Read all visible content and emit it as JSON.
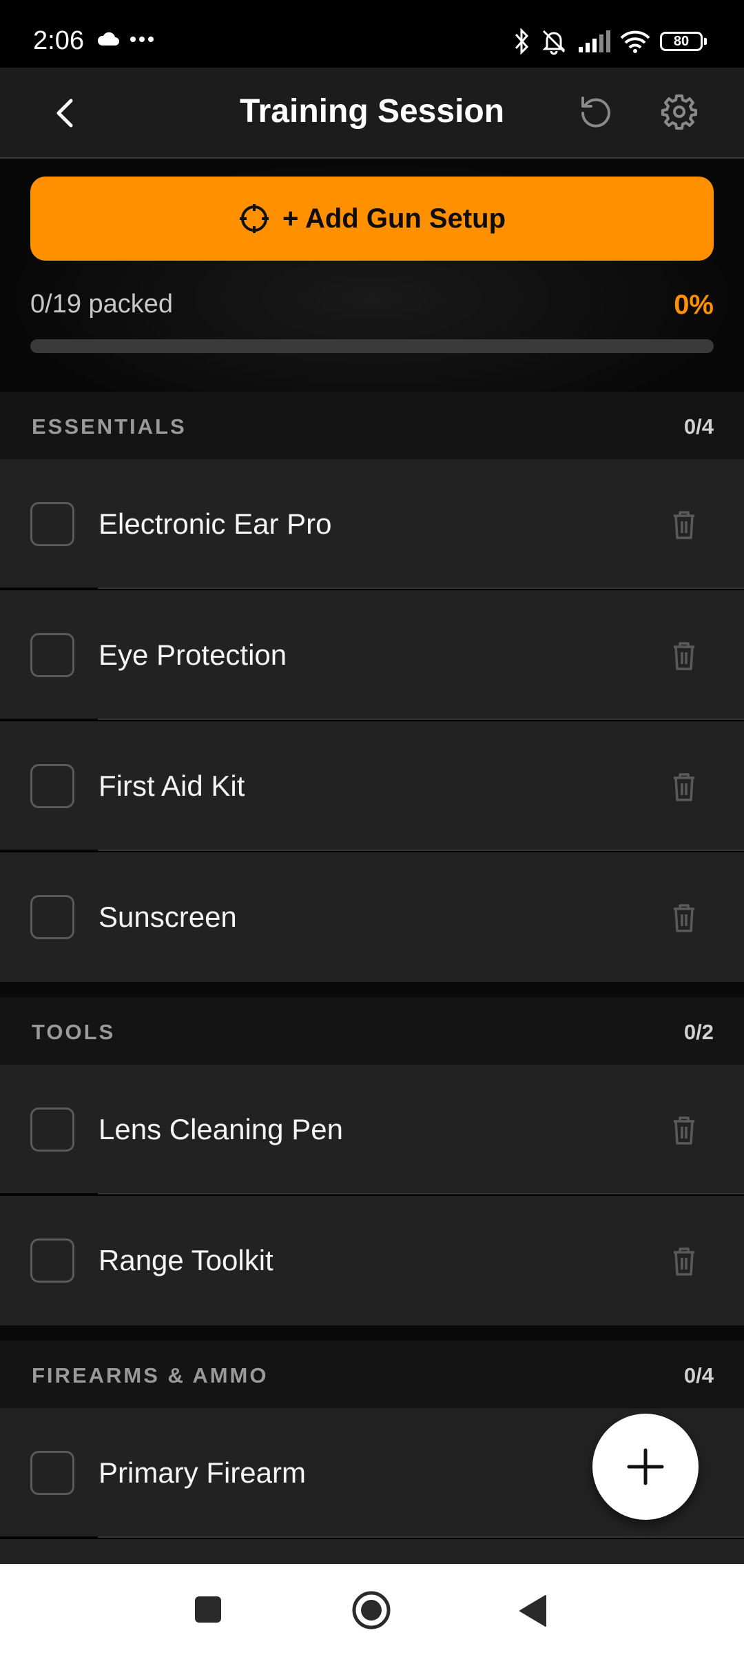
{
  "status": {
    "time": "2:06",
    "battery": "80",
    "left_icons": [
      "cloud-icon",
      "more-dots-icon"
    ],
    "right_icons": [
      "bluetooth-icon",
      "muted-bell-icon",
      "signal-icon",
      "wifi-icon",
      "battery-icon"
    ]
  },
  "header": {
    "title": "Training Session",
    "icons": [
      "back-arrow-icon",
      "reset-icon",
      "gear-icon"
    ]
  },
  "add_gun_button": {
    "label": "+ Add Gun Setup",
    "icon": "crosshair-icon"
  },
  "progress": {
    "packed_text": "0/19 packed",
    "percent_text": "0%",
    "fraction": 0,
    "accent": "#ff9000"
  },
  "sections": [
    {
      "title": "ESSENTIALS",
      "count": "0/4",
      "items": [
        {
          "label": "Electronic Ear Pro",
          "checked": false
        },
        {
          "label": "Eye Protection",
          "checked": false
        },
        {
          "label": "First Aid Kit",
          "checked": false
        },
        {
          "label": "Sunscreen",
          "checked": false
        }
      ]
    },
    {
      "title": "TOOLS",
      "count": "0/2",
      "items": [
        {
          "label": "Lens Cleaning Pen",
          "checked": false
        },
        {
          "label": "Range Toolkit",
          "checked": false
        }
      ]
    },
    {
      "title": "FIREARMS & AMMO",
      "count": "0/4",
      "items": [
        {
          "label": "Primary Firearm",
          "checked": false
        }
      ]
    }
  ],
  "fab": {
    "icon": "plus-icon"
  },
  "nav": {
    "icons": [
      "recents-square-icon",
      "home-circle-icon",
      "back-triangle-icon"
    ]
  }
}
